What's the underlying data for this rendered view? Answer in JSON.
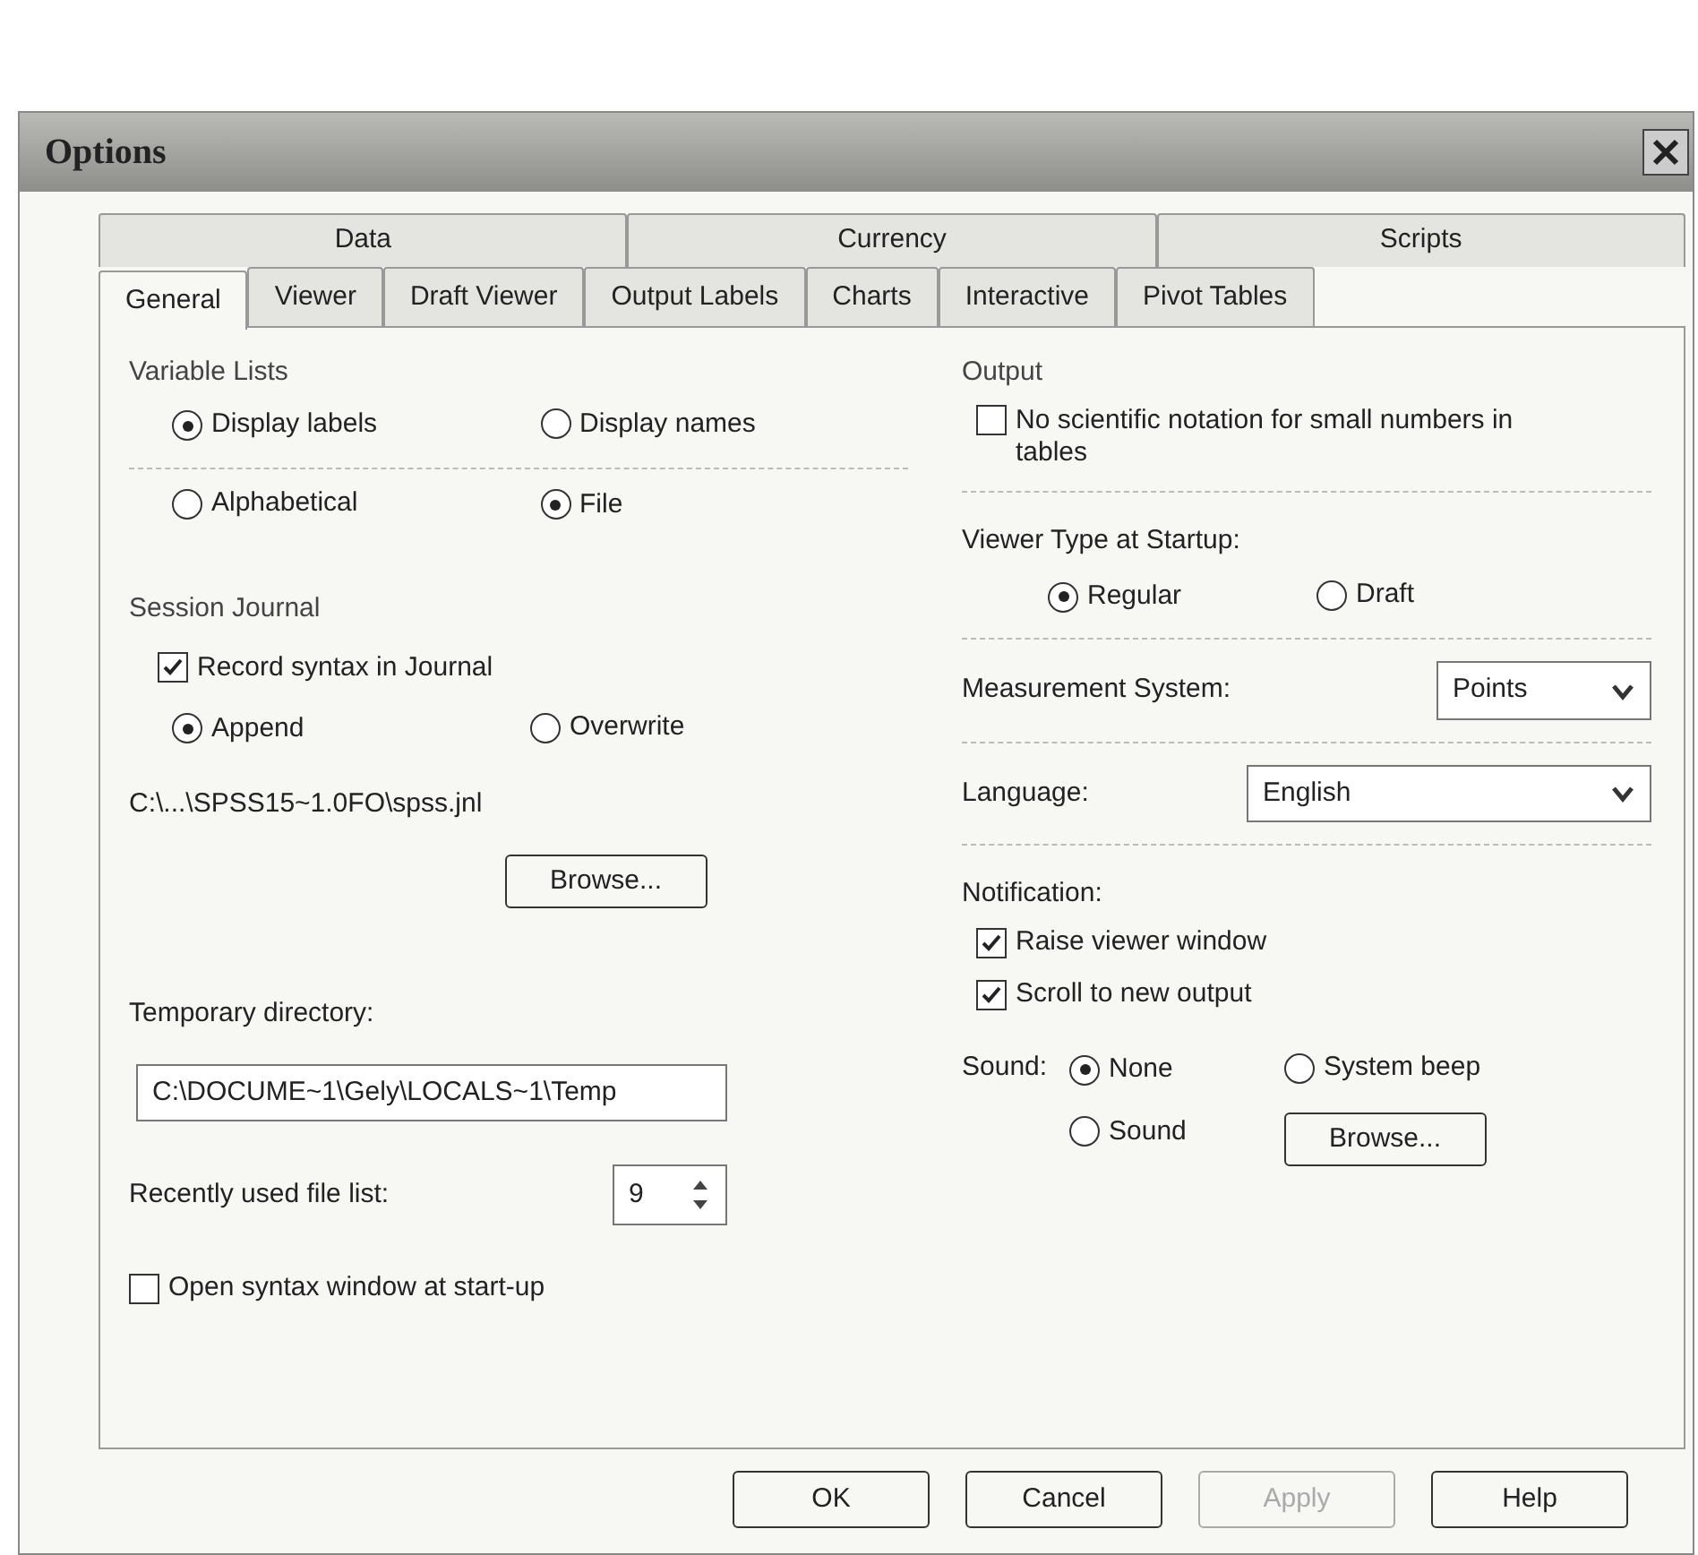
{
  "window": {
    "title": "Options"
  },
  "tab_rows": [
    [
      {
        "label": "Data",
        "selected": false
      },
      {
        "label": "Currency",
        "selected": false
      },
      {
        "label": "Scripts",
        "selected": false
      }
    ],
    [
      {
        "label": "General",
        "selected": true
      },
      {
        "label": "Viewer",
        "selected": false
      },
      {
        "label": "Draft Viewer",
        "selected": false
      },
      {
        "label": "Output Labels",
        "selected": false
      },
      {
        "label": "Charts",
        "selected": false
      },
      {
        "label": "Interactive",
        "selected": false
      },
      {
        "label": "Pivot Tables",
        "selected": false
      }
    ]
  ],
  "variable_lists": {
    "title": "Variable Lists",
    "display": [
      {
        "label": "Display labels",
        "selected": true
      },
      {
        "label": "Display names",
        "selected": false
      }
    ],
    "order": [
      {
        "label": "Alphabetical",
        "selected": false
      },
      {
        "label": "File",
        "selected": true
      }
    ]
  },
  "session_journal": {
    "title": "Session Journal",
    "record": {
      "label": "Record syntax in Journal",
      "checked": true
    },
    "mode": [
      {
        "label": "Append",
        "selected": true
      },
      {
        "label": "Overwrite",
        "selected": false
      }
    ],
    "path": "C:\\...\\SPSS15~1.0FO\\spss.jnl",
    "browse": "Browse..."
  },
  "temporary_directory": {
    "label": "Temporary directory:",
    "value": "C:\\DOCUME~1\\Gely\\LOCALS~1\\Temp"
  },
  "recently_used": {
    "label": "Recently used file list:",
    "value": "9"
  },
  "open_syntax": {
    "label": "Open syntax window at start-up",
    "checked": false
  },
  "output": {
    "title": "Output",
    "no_scientific": {
      "label": "No scientific notation for small numbers in tables",
      "checked": false
    }
  },
  "viewer_type": {
    "label": "Viewer Type at Startup:",
    "options": [
      {
        "label": "Regular",
        "selected": true
      },
      {
        "label": "Draft",
        "selected": false
      }
    ]
  },
  "measurement": {
    "label": "Measurement System:",
    "value": "Points"
  },
  "language": {
    "label": "Language:",
    "value": "English"
  },
  "notification": {
    "label": "Notification:",
    "items": [
      {
        "label": "Raise viewer window",
        "checked": true
      },
      {
        "label": "Scroll to new output",
        "checked": true
      }
    ]
  },
  "sound": {
    "label": "Sound:",
    "options": [
      {
        "label": "None",
        "selected": true
      },
      {
        "label": "System beep",
        "selected": false
      },
      {
        "label": "Sound",
        "selected": false
      }
    ],
    "browse": "Browse..."
  },
  "buttons": [
    {
      "label": "OK",
      "disabled": false
    },
    {
      "label": "Cancel",
      "disabled": false
    },
    {
      "label": "Apply",
      "disabled": true
    },
    {
      "label": "Help",
      "disabled": false
    }
  ]
}
